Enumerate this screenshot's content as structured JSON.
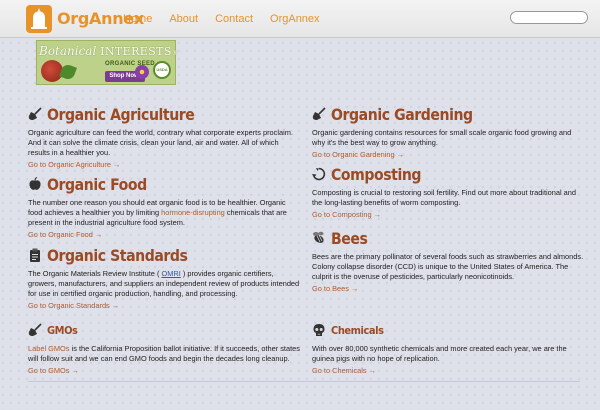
{
  "header": {
    "brand": "OrgAnnex",
    "nav": [
      "Home",
      "About",
      "Contact",
      "OrgAnnex"
    ],
    "search_placeholder": ""
  },
  "ad": {
    "title_script": "Botanical",
    "title_caps": "INTERESTS",
    "subtitle": "ORGANIC SEED",
    "badge": "USDA",
    "button": "Shop Now!"
  },
  "sections": {
    "organic_agriculture": {
      "title": "Organic Agriculture",
      "body": "Organic agriculture can feed the world, contrary what corporate experts proclaim. And it can solve the climate crisis, clean your land, air and water. All of which results in a healthier you.",
      "link": "Go to Organic Agriculture →"
    },
    "organic_gardening": {
      "title": "Organic Gardening",
      "body": "Organic gardening contains resources for small scale organic food growing and why it's the best way to grow anything.",
      "link": "Go to Organic Gardening →"
    },
    "organic_food": {
      "title": "Organic Food",
      "body_pre": "The number one reason you should eat organic food is to be healthier. Organic food achieves a healthier you by limiting ",
      "body_link": "hormone-disrupting",
      "body_post": " chemicals that are present in the industrial agriculture food system.",
      "link": "Go to Organic Food →"
    },
    "composting": {
      "title": "Composting",
      "body": "Composting is crucial to restoring soil fertility. Find out more about traditional and the long-lasting benefits of worm composting.",
      "link": "Go to Composting →"
    },
    "organic_standards": {
      "title": "Organic Standards",
      "body_pre": "The Organic Materials Review Institute ( ",
      "body_abbr": "OMRI",
      "body_post": " ) provides organic certifiers, growers, manufacturers, and suppliers an independent review of products intended for use in certified organic production, handling, and processing.",
      "link": "Go to Organic Standards →"
    },
    "bees": {
      "title": "Bees",
      "body": "Bees are the primary pollinator of several foods such as strawberries and almonds. Colony collapse disorder (CCD) is unique to the United States of America. The culprit is the overuse of pesticides, particularly neonicotinoids.",
      "link": "Go to Bees →"
    },
    "gmos": {
      "title": "GMOs",
      "body_link": "Label GMOs",
      "body_post": " is the California Proposition ballot initiative. If it succeeds, other states will follow suit and we can end GMO foods and begin the decades long cleanup.",
      "link": "Go to GMOs →"
    },
    "chemicals": {
      "title": "Chemicals",
      "body": "With over 80,000 synthetic chemicals and more created each year, we are the guinea pigs with no hope of replication.",
      "link": "Go to Chemicals →"
    }
  },
  "colors": {
    "accent": "#e8922a",
    "heading": "#9b4a24",
    "link": "#b05a2c",
    "background": "#dfe1ea"
  }
}
